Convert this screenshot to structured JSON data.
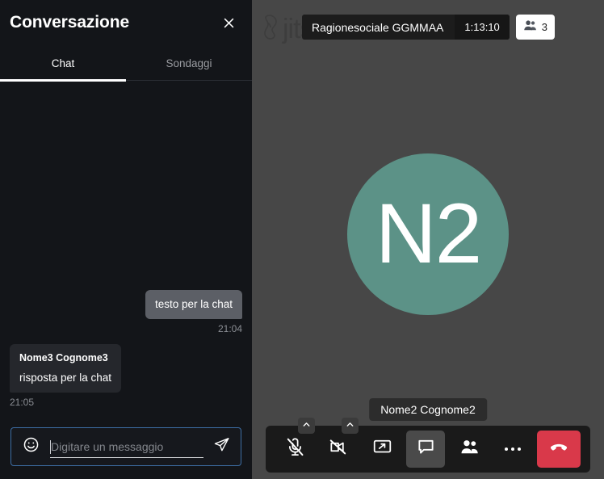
{
  "chat": {
    "title": "Conversazione",
    "close_icon": "close-icon",
    "tabs": [
      {
        "label": "Chat",
        "active": true
      },
      {
        "label": "Sondaggi",
        "active": false
      }
    ],
    "messages": [
      {
        "side": "local",
        "sender": "",
        "text": "testo per la chat",
        "time": "21:04"
      },
      {
        "side": "remote",
        "sender": "Nome3 Cognome3",
        "text": "risposta per la chat",
        "time": "21:05"
      }
    ],
    "input": {
      "placeholder": "Digitare un messaggio",
      "value": "",
      "emoji_icon": "smiley-icon",
      "send_icon": "send-icon"
    }
  },
  "video": {
    "watermark_text": "jitsi",
    "subject": "Ragionesociale GGMMAA",
    "timer": "1:13:10",
    "participants_count": "3",
    "participants_icon": "people-icon",
    "avatar_initials": "N2",
    "avatar_color": "#5c9287",
    "participant_name": "Nome2 Cognome2"
  },
  "toolbar": {
    "buttons": [
      {
        "name": "microphone",
        "icon": "microphone-muted-icon",
        "state": "muted",
        "has_expander": true
      },
      {
        "name": "camera",
        "icon": "camera-muted-icon",
        "state": "muted",
        "has_expander": true
      },
      {
        "name": "screen-share",
        "icon": "screen-share-icon",
        "state": "off",
        "has_expander": false
      },
      {
        "name": "chat",
        "icon": "chat-icon",
        "state": "on",
        "has_expander": false
      },
      {
        "name": "participants",
        "icon": "participants-icon",
        "state": "off",
        "has_expander": false
      },
      {
        "name": "more-options",
        "icon": "overflow-menu-icon",
        "state": "off",
        "has_expander": false
      },
      {
        "name": "hangup",
        "icon": "hangup-icon",
        "state": "danger",
        "has_expander": false
      }
    ],
    "hangup_color": "#d9394a"
  }
}
